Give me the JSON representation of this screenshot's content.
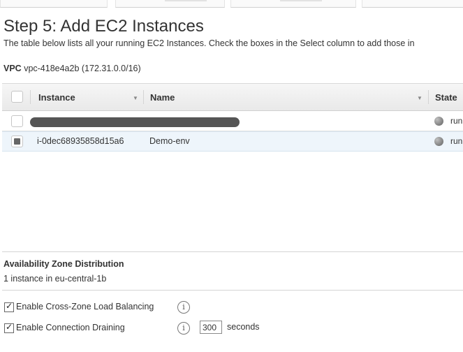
{
  "page": {
    "title": "Step 5: Add EC2 Instances",
    "description": "The table below lists all your running EC2 Instances. Check the boxes in the Select column to add those in",
    "vpc_label": "VPC",
    "vpc_value": "vpc-418e4a2b (172.31.0.0/16)"
  },
  "table": {
    "columns": [
      "Instance",
      "Name",
      "State"
    ],
    "rows": [
      {
        "instance": "",
        "name": "",
        "state": "run",
        "selected": false,
        "redacted": true
      },
      {
        "instance": "i-0dec68935858d15a6",
        "name": "Demo-env",
        "state": "run",
        "selected": true,
        "redacted": false
      }
    ]
  },
  "az": {
    "heading": "Availability Zone Distribution",
    "text": "1 instance in eu-central-1b"
  },
  "options": {
    "cross_zone_label": "Enable Cross-Zone Load Balancing",
    "draining_label": "Enable Connection Draining",
    "draining_seconds": "300",
    "seconds_label": "seconds",
    "info_glyph": "i"
  }
}
